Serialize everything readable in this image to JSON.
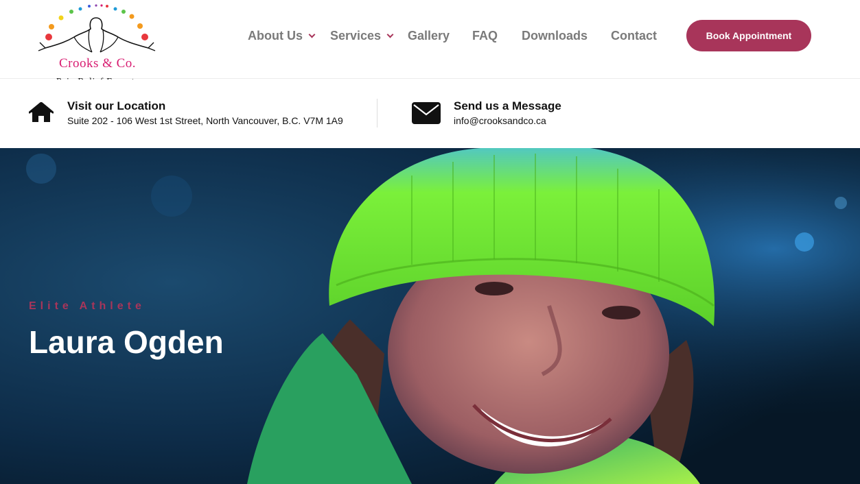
{
  "brand": {
    "name": "Crooks & Co.",
    "tagline": "Pain Relief Experts",
    "dot_colors": [
      "#e8383d",
      "#f39a1e",
      "#f2d31b",
      "#5cc44a",
      "#1f9bd7",
      "#3b5bdb",
      "#8e44ad",
      "#d81b70"
    ]
  },
  "nav": {
    "items": [
      {
        "label": "About Us",
        "has_dropdown": true
      },
      {
        "label": "Services",
        "has_dropdown": true
      },
      {
        "label": "Gallery",
        "has_dropdown": false
      },
      {
        "label": "FAQ",
        "has_dropdown": false
      },
      {
        "label": "Downloads",
        "has_dropdown": false
      },
      {
        "label": "Contact",
        "has_dropdown": false
      }
    ],
    "cta_label": "Book Appointment"
  },
  "info": {
    "location": {
      "icon": "home-icon",
      "title": "Visit our Location",
      "text": "Suite 202 - 106 West 1st Street, North Vancouver, B.C. V7M 1A9"
    },
    "message": {
      "icon": "envelope-icon",
      "title": "Send us a Message",
      "text": "info@crooksandco.ca"
    }
  },
  "hero": {
    "eyebrow": "Elite Athlete",
    "title": "Laura Ogden"
  },
  "colors": {
    "accent": "#a8355a",
    "brand_pink": "#d81b70",
    "nav_text": "#7a7a7a",
    "hero_bg": "#0b2a45",
    "beanie": "#6ee82a"
  }
}
